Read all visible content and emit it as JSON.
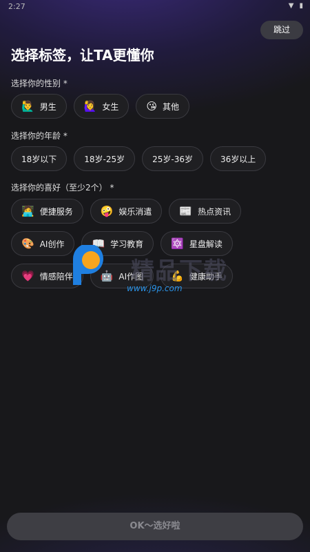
{
  "status": {
    "time": "2:27"
  },
  "header": {
    "skip_label": "跳过",
    "title": "选择标签，让TA更懂你"
  },
  "gender": {
    "label": "选择你的性别 *",
    "options": [
      {
        "emoji": "🙋‍♂️",
        "label": "男生"
      },
      {
        "emoji": "🙋‍♀️",
        "label": "女生"
      },
      {
        "emoji": "😘",
        "label": "其他"
      }
    ]
  },
  "age": {
    "label": "选择你的年龄 *",
    "options": [
      "18岁以下",
      "18岁-25岁",
      "25岁-36岁",
      "36岁以上"
    ]
  },
  "hobby": {
    "label": "选择你的喜好（至少2个） *",
    "options": [
      {
        "emoji": "🧑‍💻",
        "label": "便捷服务"
      },
      {
        "emoji": "🤪",
        "label": "娱乐消遣"
      },
      {
        "emoji": "📰",
        "label": "热点资讯"
      },
      {
        "emoji": "🎨",
        "label": "AI创作"
      },
      {
        "emoji": "📖",
        "label": "学习教育"
      },
      {
        "emoji": "🔯",
        "label": "星盘解读"
      },
      {
        "emoji": "💗",
        "label": "情感陪伴"
      },
      {
        "emoji": "🤖",
        "label": "AI作图"
      },
      {
        "emoji": "💪",
        "label": "健康助手"
      }
    ]
  },
  "footer": {
    "confirm_label": "OK～选好啦"
  },
  "watermark": {
    "text": "精品下载",
    "url": "www.j9p.com"
  },
  "colors": {
    "background": "#18181b",
    "chip_bg": "#1f1f22",
    "chip_border": "#3a3a40",
    "button_bg": "#3e3e44"
  }
}
